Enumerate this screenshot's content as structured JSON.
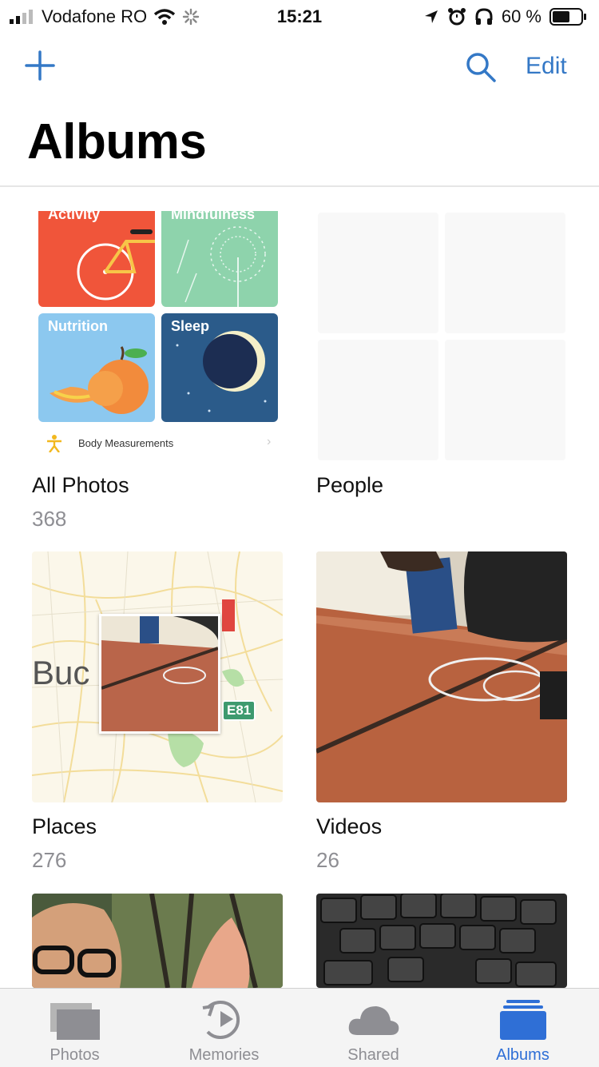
{
  "status_bar": {
    "carrier": "Vodafone RO",
    "time": "15:21",
    "battery_percent": "60 %",
    "battery_level": 0.6
  },
  "nav": {
    "edit_label": "Edit"
  },
  "page": {
    "title": "Albums"
  },
  "all_photos_collage": {
    "activity_label": "Activity",
    "mindfulness_label": "Mindfulness",
    "nutrition_label": "Nutrition",
    "sleep_label": "Sleep",
    "body_measurements_label": "Body Measurements"
  },
  "places_map": {
    "city_fragment": "Buc",
    "road_label": "E81"
  },
  "albums": [
    {
      "name": "All Photos",
      "count": "368"
    },
    {
      "name": "People",
      "count": ""
    },
    {
      "name": "Places",
      "count": "276"
    },
    {
      "name": "Videos",
      "count": "26"
    }
  ],
  "tabs": [
    {
      "label": "Photos",
      "icon": "photos-icon"
    },
    {
      "label": "Memories",
      "icon": "memories-icon"
    },
    {
      "label": "Shared",
      "icon": "cloud-icon"
    },
    {
      "label": "Albums",
      "icon": "albums-icon"
    }
  ],
  "colors": {
    "accent": "#3478c6",
    "active_tab": "#2f6fd6",
    "secondary_text": "#8e8e93"
  }
}
